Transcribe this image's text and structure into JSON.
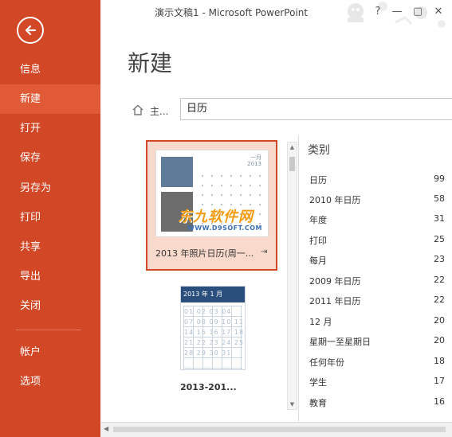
{
  "window": {
    "title": "演示文稿1 - Microsoft PowerPoint",
    "help_label": "?",
    "minimize_label": "—",
    "restore_label": "▢",
    "close_label": "✕"
  },
  "sidebar": {
    "back_icon": "back-arrow-icon",
    "items": [
      {
        "label": "信息"
      },
      {
        "label": "新建"
      },
      {
        "label": "打开"
      },
      {
        "label": "保存"
      },
      {
        "label": "另存为"
      },
      {
        "label": "打印"
      },
      {
        "label": "共享"
      },
      {
        "label": "导出"
      },
      {
        "label": "关闭"
      },
      {
        "label": "帐户"
      },
      {
        "label": "选项"
      }
    ],
    "active_index": 1,
    "colors": {
      "background": "#d24726",
      "active": "#e15a37"
    }
  },
  "main": {
    "title": "新建",
    "breadcrumb": "主...",
    "search_value": "日历"
  },
  "templates": [
    {
      "caption": "2013 年照片日历(周一...",
      "thumb_month": "一月",
      "thumb_year": "2013"
    },
    {
      "caption": "2013-201...",
      "thumb_header": "2013 年 1 月"
    }
  ],
  "watermark": {
    "line1": "东九软件网",
    "line2": "WWW.D9SOFT.COM"
  },
  "categories": {
    "title": "类别",
    "items": [
      {
        "name": "日历",
        "count": "99"
      },
      {
        "name": "2010 年日历",
        "count": "58"
      },
      {
        "name": "年度",
        "count": "31"
      },
      {
        "name": "打印",
        "count": "25"
      },
      {
        "name": "每月",
        "count": "23"
      },
      {
        "name": "2009 年日历",
        "count": "22"
      },
      {
        "name": "2011 年日历",
        "count": "22"
      },
      {
        "name": "12 月",
        "count": "20"
      },
      {
        "name": "星期一至星期日",
        "count": "20"
      },
      {
        "name": "任何年份",
        "count": "18"
      },
      {
        "name": "学生",
        "count": "17"
      },
      {
        "name": "教育",
        "count": "16"
      }
    ]
  }
}
